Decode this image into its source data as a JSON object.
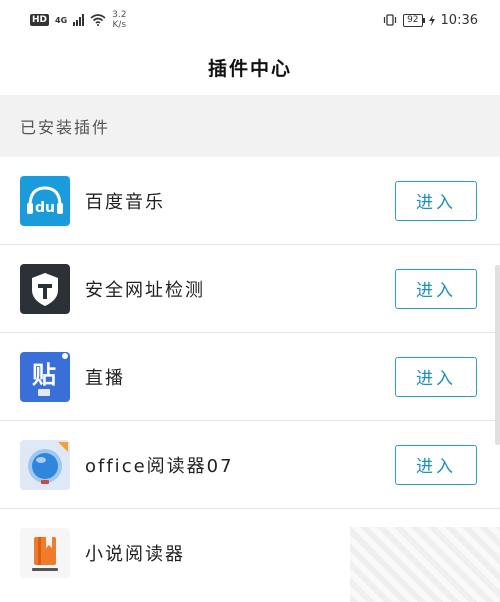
{
  "status_bar": {
    "hd": "HD",
    "network": "4G",
    "speed_value": "3.2",
    "speed_unit": "K/s",
    "battery": "92",
    "time": "10:36"
  },
  "header": {
    "title": "插件中心"
  },
  "section": {
    "label": "已安装插件"
  },
  "plugins": [
    {
      "name": "百度音乐",
      "icon": "baidu-music-icon",
      "button": "进入"
    },
    {
      "name": "安全网址检测",
      "icon": "security-shield-icon",
      "button": "进入"
    },
    {
      "name": "直播",
      "icon": "tieba-live-icon",
      "button": "进入"
    },
    {
      "name": "office阅读器07",
      "icon": "office-reader-icon",
      "button": "进入"
    },
    {
      "name": "小说阅读器",
      "icon": "novel-reader-icon"
    }
  ],
  "colors": {
    "accent": "#2a9ec4",
    "section_bg": "#f2f2f2"
  }
}
